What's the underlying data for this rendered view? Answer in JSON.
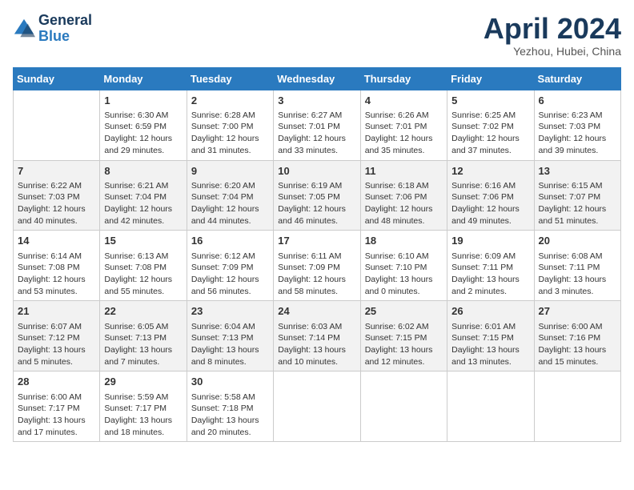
{
  "logo": {
    "line1": "General",
    "line2": "Blue"
  },
  "title": "April 2024",
  "subtitle": "Yezhou, Hubei, China",
  "columns": [
    "Sunday",
    "Monday",
    "Tuesday",
    "Wednesday",
    "Thursday",
    "Friday",
    "Saturday"
  ],
  "weeks": [
    [
      {
        "day": "",
        "info": ""
      },
      {
        "day": "1",
        "info": "Sunrise: 6:30 AM\nSunset: 6:59 PM\nDaylight: 12 hours\nand 29 minutes."
      },
      {
        "day": "2",
        "info": "Sunrise: 6:28 AM\nSunset: 7:00 PM\nDaylight: 12 hours\nand 31 minutes."
      },
      {
        "day": "3",
        "info": "Sunrise: 6:27 AM\nSunset: 7:01 PM\nDaylight: 12 hours\nand 33 minutes."
      },
      {
        "day": "4",
        "info": "Sunrise: 6:26 AM\nSunset: 7:01 PM\nDaylight: 12 hours\nand 35 minutes."
      },
      {
        "day": "5",
        "info": "Sunrise: 6:25 AM\nSunset: 7:02 PM\nDaylight: 12 hours\nand 37 minutes."
      },
      {
        "day": "6",
        "info": "Sunrise: 6:23 AM\nSunset: 7:03 PM\nDaylight: 12 hours\nand 39 minutes."
      }
    ],
    [
      {
        "day": "7",
        "info": "Sunrise: 6:22 AM\nSunset: 7:03 PM\nDaylight: 12 hours\nand 40 minutes."
      },
      {
        "day": "8",
        "info": "Sunrise: 6:21 AM\nSunset: 7:04 PM\nDaylight: 12 hours\nand 42 minutes."
      },
      {
        "day": "9",
        "info": "Sunrise: 6:20 AM\nSunset: 7:04 PM\nDaylight: 12 hours\nand 44 minutes."
      },
      {
        "day": "10",
        "info": "Sunrise: 6:19 AM\nSunset: 7:05 PM\nDaylight: 12 hours\nand 46 minutes."
      },
      {
        "day": "11",
        "info": "Sunrise: 6:18 AM\nSunset: 7:06 PM\nDaylight: 12 hours\nand 48 minutes."
      },
      {
        "day": "12",
        "info": "Sunrise: 6:16 AM\nSunset: 7:06 PM\nDaylight: 12 hours\nand 49 minutes."
      },
      {
        "day": "13",
        "info": "Sunrise: 6:15 AM\nSunset: 7:07 PM\nDaylight: 12 hours\nand 51 minutes."
      }
    ],
    [
      {
        "day": "14",
        "info": "Sunrise: 6:14 AM\nSunset: 7:08 PM\nDaylight: 12 hours\nand 53 minutes."
      },
      {
        "day": "15",
        "info": "Sunrise: 6:13 AM\nSunset: 7:08 PM\nDaylight: 12 hours\nand 55 minutes."
      },
      {
        "day": "16",
        "info": "Sunrise: 6:12 AM\nSunset: 7:09 PM\nDaylight: 12 hours\nand 56 minutes."
      },
      {
        "day": "17",
        "info": "Sunrise: 6:11 AM\nSunset: 7:09 PM\nDaylight: 12 hours\nand 58 minutes."
      },
      {
        "day": "18",
        "info": "Sunrise: 6:10 AM\nSunset: 7:10 PM\nDaylight: 13 hours\nand 0 minutes."
      },
      {
        "day": "19",
        "info": "Sunrise: 6:09 AM\nSunset: 7:11 PM\nDaylight: 13 hours\nand 2 minutes."
      },
      {
        "day": "20",
        "info": "Sunrise: 6:08 AM\nSunset: 7:11 PM\nDaylight: 13 hours\nand 3 minutes."
      }
    ],
    [
      {
        "day": "21",
        "info": "Sunrise: 6:07 AM\nSunset: 7:12 PM\nDaylight: 13 hours\nand 5 minutes."
      },
      {
        "day": "22",
        "info": "Sunrise: 6:05 AM\nSunset: 7:13 PM\nDaylight: 13 hours\nand 7 minutes."
      },
      {
        "day": "23",
        "info": "Sunrise: 6:04 AM\nSunset: 7:13 PM\nDaylight: 13 hours\nand 8 minutes."
      },
      {
        "day": "24",
        "info": "Sunrise: 6:03 AM\nSunset: 7:14 PM\nDaylight: 13 hours\nand 10 minutes."
      },
      {
        "day": "25",
        "info": "Sunrise: 6:02 AM\nSunset: 7:15 PM\nDaylight: 13 hours\nand 12 minutes."
      },
      {
        "day": "26",
        "info": "Sunrise: 6:01 AM\nSunset: 7:15 PM\nDaylight: 13 hours\nand 13 minutes."
      },
      {
        "day": "27",
        "info": "Sunrise: 6:00 AM\nSunset: 7:16 PM\nDaylight: 13 hours\nand 15 minutes."
      }
    ],
    [
      {
        "day": "28",
        "info": "Sunrise: 6:00 AM\nSunset: 7:17 PM\nDaylight: 13 hours\nand 17 minutes."
      },
      {
        "day": "29",
        "info": "Sunrise: 5:59 AM\nSunset: 7:17 PM\nDaylight: 13 hours\nand 18 minutes."
      },
      {
        "day": "30",
        "info": "Sunrise: 5:58 AM\nSunset: 7:18 PM\nDaylight: 13 hours\nand 20 minutes."
      },
      {
        "day": "",
        "info": ""
      },
      {
        "day": "",
        "info": ""
      },
      {
        "day": "",
        "info": ""
      },
      {
        "day": "",
        "info": ""
      }
    ]
  ]
}
